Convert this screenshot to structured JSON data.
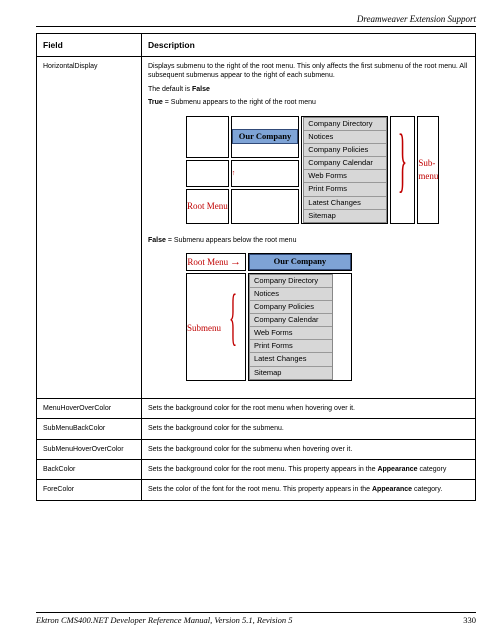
{
  "running_head": "Dreamweaver Extension Support",
  "columns": {
    "field": "Field",
    "desc": "Description"
  },
  "rows": [
    {
      "field": "HorizontalDisplay",
      "para1": "Displays submenu to the right of the root menu. This only affects the first submenu of the root menu. All subsequent submenus appear to the right of each submenu.",
      "para2a": "The default is ",
      "para2b": "False",
      "para3a": "True",
      "para3b": " = Submenu appears to the right of the root menu",
      "para4a": "False",
      "para4b": " = Submenu appears below the root menu"
    },
    {
      "field": "MenuHoverOverColor",
      "desc": "Sets the background color for the root menu when hovering over it."
    },
    {
      "field": "SubMenuBackColor",
      "desc": "Sets the background color for the submenu."
    },
    {
      "field": "SubMenuHoverOverColor",
      "desc": "Sets the background color for the submenu when hovering over it."
    },
    {
      "field": "BackColor",
      "desc_a": "Sets the background color for the root menu. This property appears in the ",
      "desc_b": "Appearance",
      "desc_c": " category"
    },
    {
      "field": "ForeColor",
      "desc_a": "Sets the color of the font for the root menu. This property appears in the ",
      "desc_b": "Appearance",
      "desc_c": " category."
    }
  ],
  "menu": {
    "root": "Our Company",
    "items": [
      "Company Directory",
      "Notices",
      "Company Policies",
      "Company Calendar",
      "Web Forms",
      "Print Forms",
      "Latest Changes",
      "Sitemap"
    ]
  },
  "labels": {
    "root_menu": "Root Menu",
    "sub_menu_stack": "Sub-\nmenu",
    "submenu_word": "Submenu"
  },
  "footer": {
    "text": "Ektron CMS400.NET Developer Reference Manual, Version 5.1, Revision 5",
    "page": "330"
  }
}
